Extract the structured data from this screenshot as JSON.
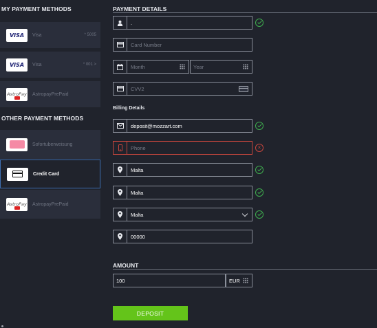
{
  "left": {
    "my_title": "MY PAYMENT METHODS",
    "my_methods": [
      {
        "label": "Visa",
        "logo": "VISA",
        "suffix": "* 5005"
      },
      {
        "label": "Visa",
        "logo": "VISA",
        "suffix": "* 001 >"
      },
      {
        "label": "AstropayPrePaid",
        "logo": "AstroPay"
      }
    ],
    "other_title": "OTHER PAYMENT METHODS",
    "other_methods": [
      {
        "label": "Sofortuberweisung",
        "logo": "sofort"
      },
      {
        "label": "Credit Card",
        "logo": "credit-card"
      },
      {
        "label": "AstropayPrePaid",
        "logo": "AstroPay"
      }
    ]
  },
  "payment": {
    "title": "PAYMENT DETAILS",
    "name_value": ".",
    "card_number_placeholder": "Card Number",
    "month_placeholder": "Month",
    "year_placeholder": "Year",
    "cvv_placeholder": "CVV2"
  },
  "billing": {
    "title": "Billing Details",
    "email_value": "deposit@mozzart.com",
    "phone_placeholder": "Phone",
    "address1_value": "Malta",
    "address2_value": "Malta",
    "country_value": "Malta",
    "zip_value": "00000"
  },
  "amount": {
    "title": "AMOUNT",
    "value": "100",
    "currency": "EUR"
  },
  "deposit_label": "DEPOSIT",
  "colors": {
    "background": "#20232c",
    "item_bg": "#2a2e3b",
    "valid": "#3fae4f",
    "error": "#c9463d",
    "deposit": "#64c41a",
    "selected_border": "#3e6fb3"
  }
}
